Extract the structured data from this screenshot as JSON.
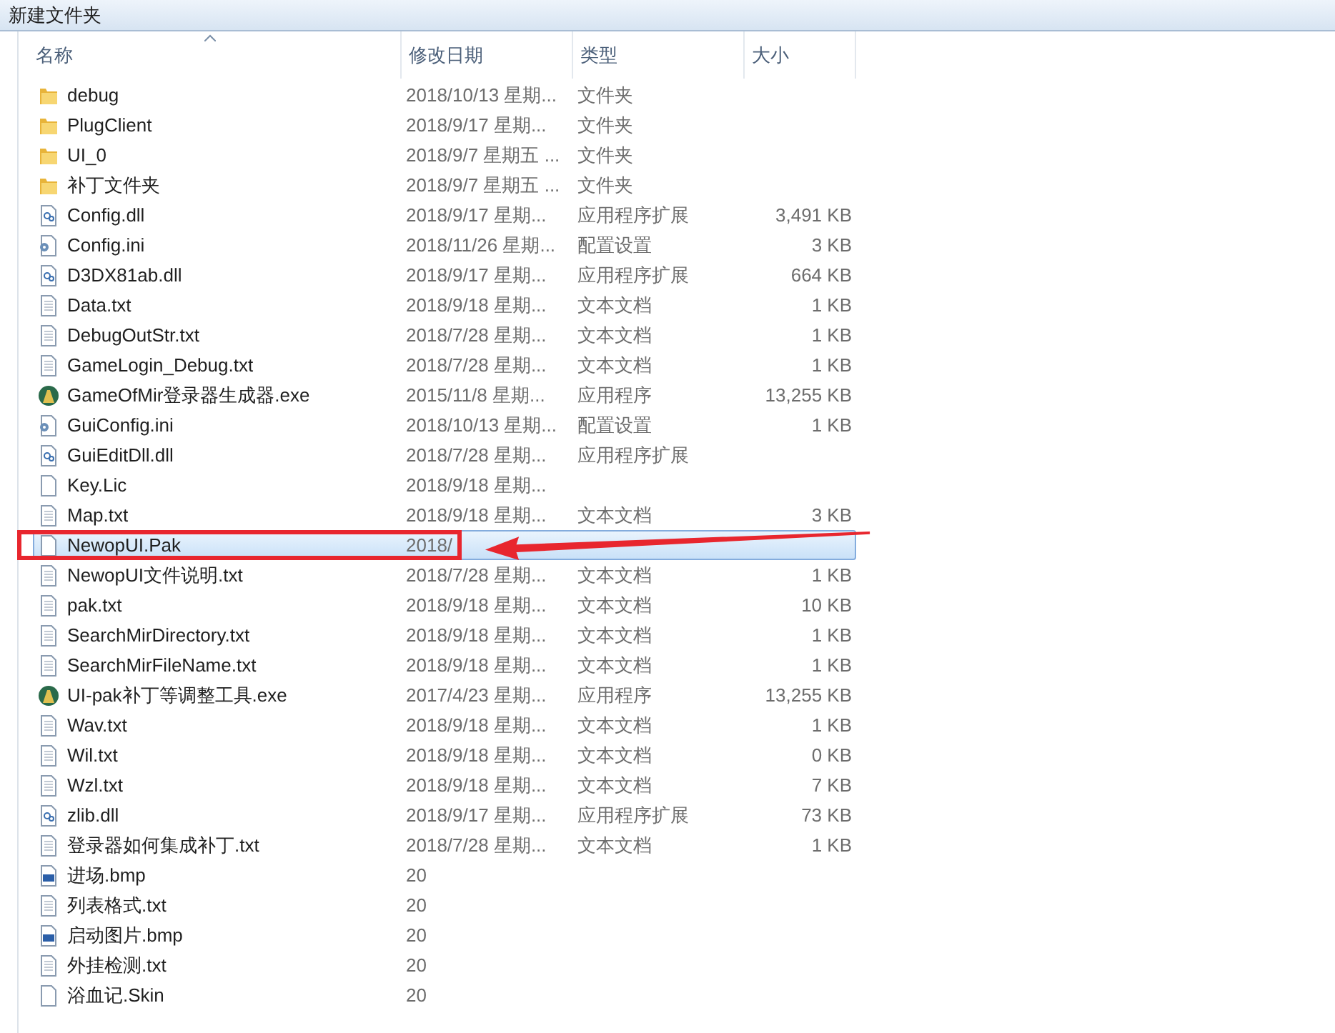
{
  "window": {
    "title": "新建文件夹"
  },
  "columns": [
    {
      "label": "名称",
      "sorted": true
    },
    {
      "label": "修改日期",
      "sorted": false
    },
    {
      "label": "类型",
      "sorted": false
    },
    {
      "label": "大小",
      "sorted": false
    }
  ],
  "files": [
    {
      "kind": "folder",
      "name": "debug",
      "date": "2018/10/13 星期...",
      "type": "文件夹",
      "selected": false
    },
    {
      "kind": "folder",
      "name": "PlugClient",
      "date": "2018/9/17 星期...",
      "type": "文件夹",
      "selected": false
    },
    {
      "kind": "folder",
      "name": "UI_0",
      "date": "2018/9/7 星期五 ...",
      "type": "文件夹",
      "selected": false
    },
    {
      "kind": "folder",
      "name": "补丁文件夹",
      "date": "2018/9/7 星期五 ...",
      "type": "文件夹",
      "selected": false
    },
    {
      "kind": "dll",
      "name": "Config.dll",
      "date": "2018/9/17 星期...",
      "type": "应用程序扩展",
      "size": "3,491 KB",
      "selected": false
    },
    {
      "kind": "ini",
      "name": "Config.ini",
      "date": "2018/11/26 星期...",
      "type": "配置设置",
      "size": "3 KB",
      "selected": false
    },
    {
      "kind": "dll",
      "name": "D3DX81ab.dll",
      "date": "2018/9/17 星期...",
      "type": "应用程序扩展",
      "size": "664 KB",
      "selected": false
    },
    {
      "kind": "txt",
      "name": "Data.txt",
      "date": "2018/9/18 星期...",
      "type": "文本文档",
      "size": "1 KB",
      "selected": false
    },
    {
      "kind": "txt",
      "name": "DebugOutStr.txt",
      "date": "2018/7/28 星期...",
      "type": "文本文档",
      "size": "1 KB",
      "selected": false
    },
    {
      "kind": "txt",
      "name": "GameLogin_Debug.txt",
      "date": "2018/7/28 星期...",
      "type": "文本文档",
      "size": "1 KB",
      "selected": false
    },
    {
      "kind": "exe",
      "name": "GameOfMir登录器生成器.exe",
      "date": "2015/11/8 星期...",
      "type": "应用程序",
      "size": "13,255 KB",
      "selected": false
    },
    {
      "kind": "ini",
      "name": "GuiConfig.ini",
      "date": "2018/10/13 星期...",
      "type": "配置设置",
      "size": "1 KB",
      "selected": false
    },
    {
      "kind": "dll",
      "name": "GuiEditDll.dll",
      "date": "2018/7/28 星期...",
      "type": "应用程序扩展",
      "selected": false
    },
    {
      "kind": "blank",
      "name": "Key.Lic",
      "date": "2018/9/18 星期...",
      "selected": false
    },
    {
      "kind": "txt",
      "name": "Map.txt",
      "date": "2018/9/18 星期...",
      "type": "文本文档",
      "size": "3 KB",
      "selected": false
    },
    {
      "kind": "blank",
      "name": "NewopUI.Pak",
      "date": "2018/",
      "selected": true
    },
    {
      "kind": "txt",
      "name": "NewopUI文件说明.txt",
      "date": "2018/7/28 星期...",
      "type": "文本文档",
      "size": "1 KB",
      "selected": false
    },
    {
      "kind": "txt",
      "name": "pak.txt",
      "date": "2018/9/18 星期...",
      "type": "文本文档",
      "size": "10 KB",
      "selected": false
    },
    {
      "kind": "txt",
      "name": "SearchMirDirectory.txt",
      "date": "2018/9/18 星期...",
      "type": "文本文档",
      "size": "1 KB",
      "selected": false
    },
    {
      "kind": "txt",
      "name": "SearchMirFileName.txt",
      "date": "2018/9/18 星期...",
      "type": "文本文档",
      "size": "1 KB",
      "selected": false
    },
    {
      "kind": "exe",
      "name": "UI-pak补丁等调整工具.exe",
      "date": "2017/4/23 星期...",
      "type": "应用程序",
      "size": "13,255 KB",
      "selected": false
    },
    {
      "kind": "txt",
      "name": "Wav.txt",
      "date": "2018/9/18 星期...",
      "type": "文本文档",
      "size": "1 KB",
      "selected": false
    },
    {
      "kind": "txt",
      "name": "Wil.txt",
      "date": "2018/9/18 星期...",
      "type": "文本文档",
      "size": "0 KB",
      "selected": false
    },
    {
      "kind": "txt",
      "name": "Wzl.txt",
      "date": "2018/9/18 星期...",
      "type": "文本文档",
      "size": "7 KB",
      "selected": false
    },
    {
      "kind": "dll",
      "name": "zlib.dll",
      "date": "2018/9/17 星期...",
      "type": "应用程序扩展",
      "size": "73 KB",
      "selected": false
    },
    {
      "kind": "txt",
      "name": "登录器如何集成补丁.txt",
      "date": "2018/7/28 星期...",
      "type": "文本文档",
      "size": "1 KB",
      "selected": false
    },
    {
      "kind": "ps",
      "name": "进场.bmp",
      "date": "20",
      "selected": false
    },
    {
      "kind": "txt",
      "name": "列表格式.txt",
      "date": "20",
      "selected": false
    },
    {
      "kind": "ps",
      "name": "启动图片.bmp",
      "date": "20",
      "selected": false
    },
    {
      "kind": "txt",
      "name": "外挂检测.txt",
      "date": "20",
      "selected": false
    },
    {
      "kind": "blank",
      "name": "浴血记.Skin",
      "date": "20",
      "selected": false
    }
  ],
  "annotation": {
    "highlight_box": true,
    "arrow": true
  }
}
